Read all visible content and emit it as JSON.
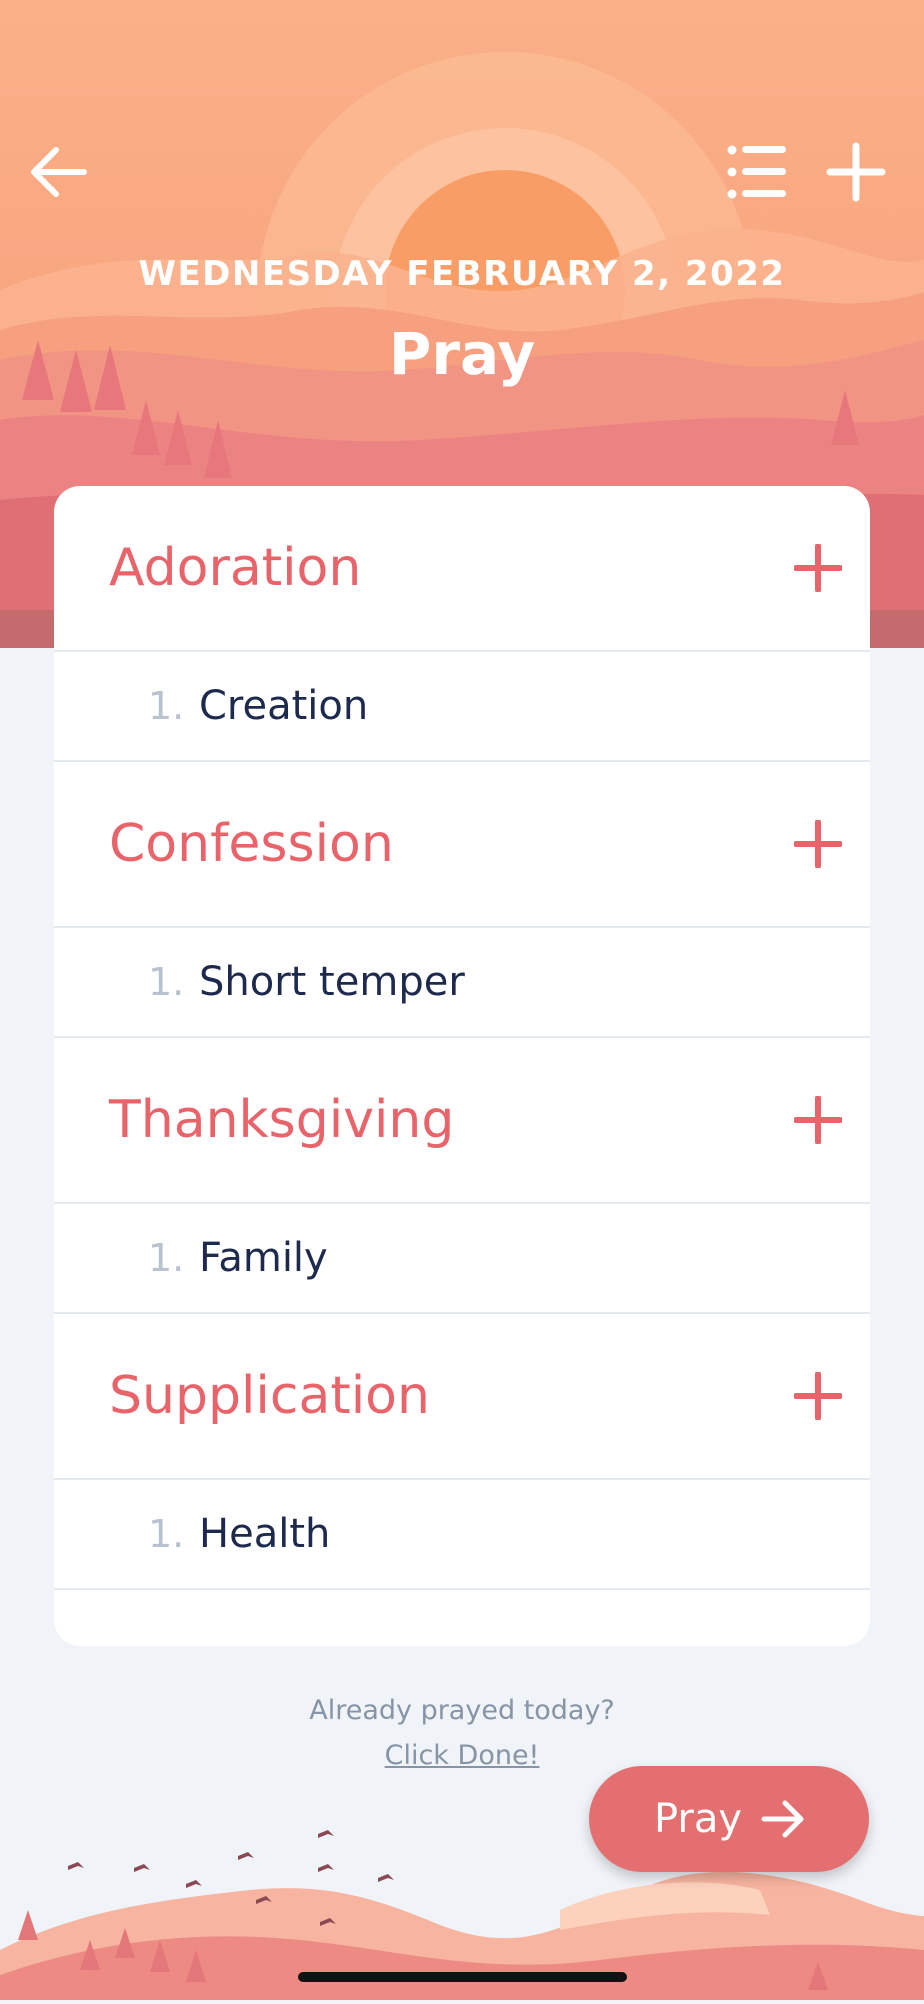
{
  "header": {
    "date": "WEDNESDAY FEBRUARY 2, 2022",
    "title": "Pray",
    "icons": [
      "back-arrow-icon",
      "list-icon",
      "plus-icon"
    ]
  },
  "sections": [
    {
      "name": "Adoration",
      "items": [
        {
          "num": "1.",
          "text": "Creation"
        }
      ]
    },
    {
      "name": "Confession",
      "items": [
        {
          "num": "1.",
          "text": "Short temper"
        }
      ]
    },
    {
      "name": "Thanksgiving",
      "items": [
        {
          "num": "1.",
          "text": "Family"
        }
      ]
    },
    {
      "name": "Supplication",
      "items": [
        {
          "num": "1.",
          "text": "Health"
        }
      ]
    }
  ],
  "footer": {
    "question": "Already prayed today?",
    "link": "Click Done!"
  },
  "pray_button": {
    "label": "Pray"
  },
  "colors": {
    "accent": "#e8646a",
    "button": "#e36f71",
    "item_text": "#1e2a4d",
    "background": "#f0f4f8"
  }
}
